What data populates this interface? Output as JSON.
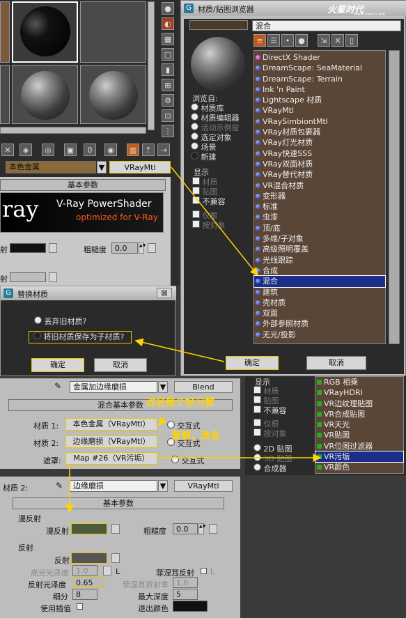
{
  "material_editor": {
    "material_type_button": "VRayMtl",
    "material_name": "本色金属",
    "basic_params_title": "基本参数",
    "banner_line1": "V-Ray PowerShader",
    "banner_line2": "optimized for V-Ray",
    "banner_logo": "ray",
    "diffuse_label": "射",
    "roughness_label": "粗糙度",
    "roughness_value": "0.0",
    "reflect_label": "射"
  },
  "browser": {
    "title": "材质/贴图浏览器",
    "search_value": "混合",
    "browse_from_title": "浏览自:",
    "browse_from": [
      "材质库",
      "材质编辑器",
      "活动示例窗",
      "选定对象",
      "场景",
      "新建"
    ],
    "show_title": "显示",
    "show_options": [
      "材质",
      "贴图",
      "不兼容"
    ],
    "extra_options": [
      "仅根",
      "按对象"
    ],
    "list": [
      {
        "label": "DirectX Shader",
        "dot": "pink"
      },
      {
        "label": "DreamScape: SeaMaterial",
        "dot": "blue"
      },
      {
        "label": "DreamScape: Terrain",
        "dot": "blue"
      },
      {
        "label": "Ink 'n Paint",
        "dot": "blue"
      },
      {
        "label": "Lightscape 材质",
        "dot": "blue"
      },
      {
        "label": "VRayMtl",
        "dot": "blue"
      },
      {
        "label": "VRaySimbiontMtl",
        "dot": "blue"
      },
      {
        "label": "VRay材质包裹器",
        "dot": "blue"
      },
      {
        "label": "VRay灯光材质",
        "dot": "blue"
      },
      {
        "label": "VRay快速SSS",
        "dot": "blue"
      },
      {
        "label": "VRay双面材质",
        "dot": "blue"
      },
      {
        "label": "VRay替代材质",
        "dot": "blue"
      },
      {
        "label": "VR混合材质",
        "dot": "blue"
      },
      {
        "label": "变形器",
        "dot": "blue"
      },
      {
        "label": "标准",
        "dot": "blue"
      },
      {
        "label": "虫漆",
        "dot": "blue"
      },
      {
        "label": "顶/底",
        "dot": "blue"
      },
      {
        "label": "多维/子对象",
        "dot": "blue"
      },
      {
        "label": "高级照明覆盖",
        "dot": "blue"
      },
      {
        "label": "光线跟踪",
        "dot": "blue"
      },
      {
        "label": "合成",
        "dot": "blue"
      },
      {
        "label": "混合",
        "dot": "blue"
      },
      {
        "label": "建筑",
        "dot": "blue"
      },
      {
        "label": "壳材质",
        "dot": "blue"
      },
      {
        "label": "双面",
        "dot": "blue"
      },
      {
        "label": "外部参照材质",
        "dot": "blue"
      },
      {
        "label": "无光/投影",
        "dot": "blue"
      }
    ],
    "selected_index": 21,
    "ok": "确定",
    "cancel": "取消"
  },
  "replace_dialog": {
    "title": "替换材质",
    "option1": "丢弃旧材质?",
    "option2": "将旧材质保存为子材质?",
    "ok": "确定",
    "cancel": "取消"
  },
  "blend": {
    "name": "金属加边缘磨损",
    "type": "Blend",
    "rollout": "混合基本参数",
    "mat1_label": "材质 1:",
    "mat1_value": "本色金属（VRayMtl）",
    "mat2_label": "材质 2:",
    "mat2_value": "边缘磨损（VRayMtl）",
    "mask_label": "遮罩:",
    "mask_value": "Map #26（VR污垢）",
    "interactive": "交互式",
    "annot1": "改名是个好习惯",
    "annot2": "复制，改名"
  },
  "map_list": {
    "show_title": "显示",
    "show_options": [
      "材质",
      "贴图",
      "不兼容"
    ],
    "extra_options": [
      "仅根",
      "按对象",
      "2D 贴图",
      "3D 贴图",
      "合成器"
    ],
    "items": [
      "RGB 相乘",
      "VRayHDRI",
      "VR边纹理贴图",
      "VR合成贴图",
      "VR天光",
      "VR贴图",
      "VR位图过滤器",
      "VR污垢",
      "VR颜色"
    ],
    "selected_index": 7
  },
  "mat2_panel": {
    "label": "材质 2:",
    "name": "边缘磨损",
    "type": "VRayMtl",
    "rollout": "基本参数",
    "diffuse_group": "漫反射",
    "diffuse_label": "漫反射",
    "roughness_label": "粗糙度",
    "roughness_value": "0.0",
    "reflect_group": "反射",
    "reflect_label": "反射",
    "hilight_gloss_label": "高光光泽度",
    "hilight_gloss_value": "1.0",
    "fresnel_label": "菲涅耳反射",
    "refl_gloss_label": "反射光泽度",
    "refl_gloss_value": "0.65",
    "fresnel_ior_label": "菲涅耳折射率",
    "fresnel_ior_value": "1.6",
    "subdivs_label": "细分",
    "subdivs_value": "8",
    "max_depth_label": "最大深度",
    "max_depth_value": "5",
    "use_interp_label": "使用插值",
    "exit_color_label": "退出颜色",
    "lock_label": "L"
  },
  "watermark": "火星时代",
  "watermark_url": "www.hxsd.com",
  "colors": {
    "accent": "#e8c400",
    "list_bg": "#5a4636",
    "selected": "#1a2e8a"
  }
}
